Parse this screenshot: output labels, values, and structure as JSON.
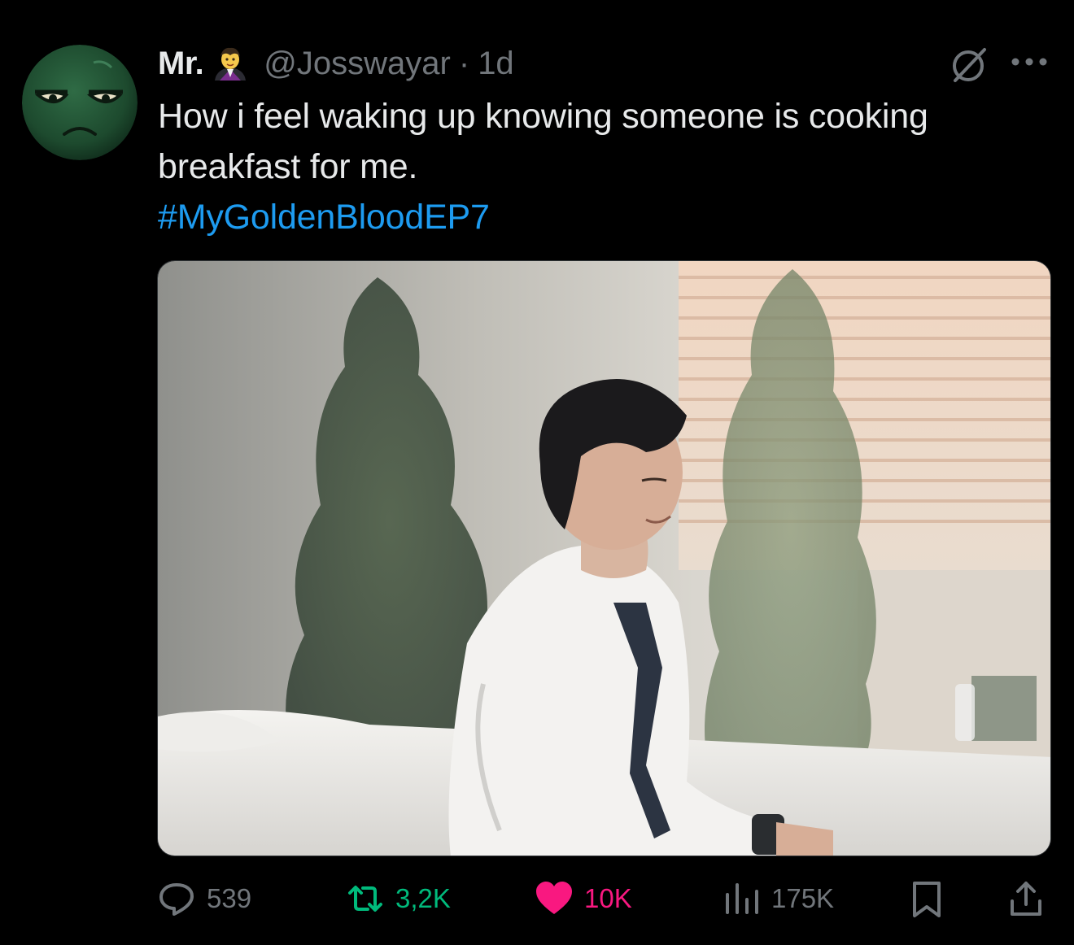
{
  "tweet": {
    "author": {
      "display_name": "Mr.",
      "name_emoji": "man-vampire-emoji",
      "handle": "@Josswayar",
      "separator": "·",
      "time": "1d",
      "avatar": "green-ball-face-avatar"
    },
    "text": "How i feel waking up knowing someone is cooking breakfast for me.",
    "hashtag": "#MyGoldenBloodEP7",
    "media": "photo of a man in a white shirt and loose tie sitting on a bed, eyes closed, smiling",
    "stats": {
      "replies": "539",
      "retweets": "3,2K",
      "likes": "10K",
      "views": "175K"
    },
    "icons": [
      "grok-icon",
      "more-icon",
      "reply-icon",
      "retweet-icon",
      "heart-icon",
      "views-icon",
      "bookmark-icon",
      "share-icon"
    ]
  },
  "colors": {
    "background": "#000000",
    "text": "#e7e9ea",
    "secondary": "#71767b",
    "link": "#1d9bf0",
    "retweet": "#00ba7c",
    "like": "#f91880"
  }
}
